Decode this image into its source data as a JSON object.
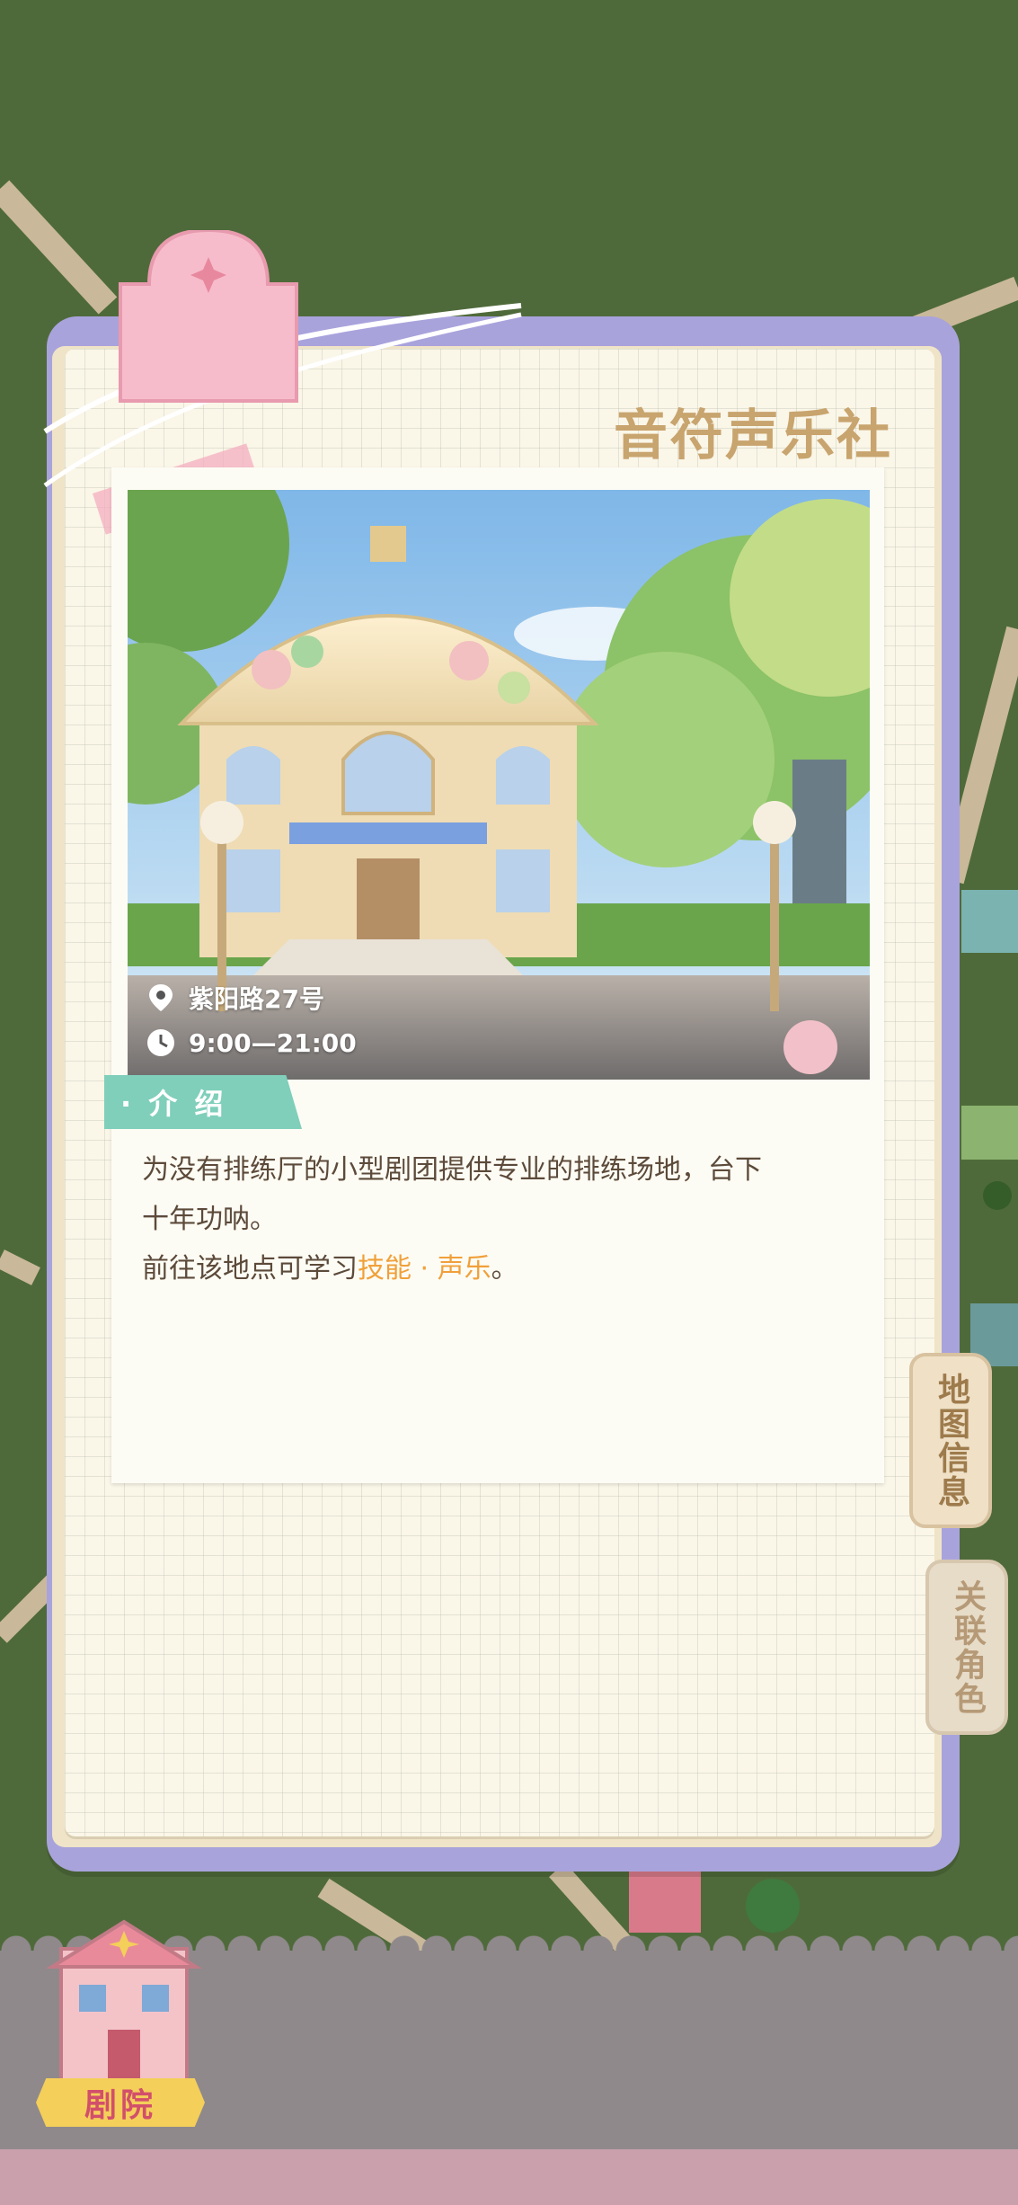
{
  "location": {
    "title": "音符声乐社",
    "address": "紫阳路27号",
    "hours": "9:00—21:00"
  },
  "intro": {
    "label": "· 介 绍",
    "line1": "为没有排练厅的小型剧团提供专业的排练场地，台下",
    "line2": "十年功呐。",
    "learn_prefix": "前往该地点可学习",
    "learn_highlight": "技能 · 声乐",
    "learn_suffix": "。"
  },
  "tabs": {
    "map_info": "地图信息",
    "related_characters": "关联角色"
  },
  "bottom_bar": {
    "theatre_label": "剧院"
  },
  "icons": [
    "location-pin-icon",
    "clock-icon",
    "sparkle-icon",
    "theatre-building-icon"
  ],
  "colors": {
    "map_green": "#4f6a3a",
    "card_border": "#a9a3dc",
    "title_gold": "#c8a46e",
    "ribbon_teal": "#7fcfba",
    "highlight_orange": "#f0a03a",
    "clip_pink": "#f6bccb"
  }
}
